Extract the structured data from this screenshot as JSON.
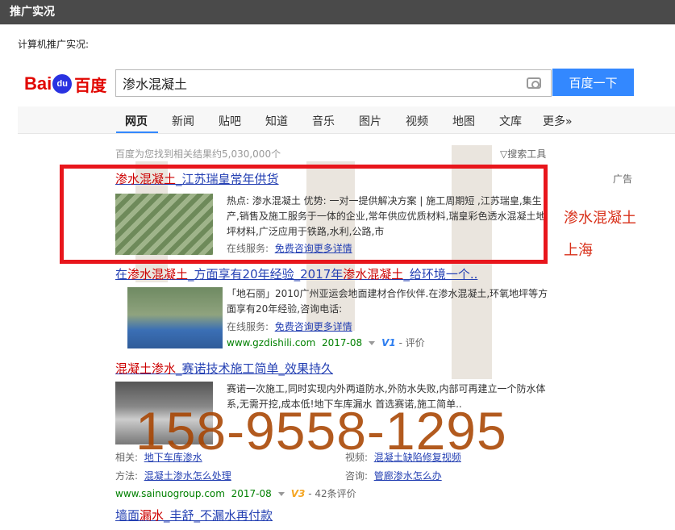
{
  "window": {
    "title": "推广实况"
  },
  "subtitle": "计算机推广实况:",
  "logo": {
    "bai": "Bai",
    "du": "du",
    "cn": "百度"
  },
  "search": {
    "query": "渗水混凝土",
    "button": "百度一下"
  },
  "nav": [
    "网页",
    "新闻",
    "贴吧",
    "知道",
    "音乐",
    "图片",
    "视频",
    "地图",
    "文库",
    "更多»"
  ],
  "result_count": "百度为您找到相关结果约5,030,000个",
  "search_tools": "搜索工具",
  "ad_label": "广告",
  "side_notes": [
    "渗水混凝土",
    "上海"
  ],
  "results": [
    {
      "title_em": "渗水混凝土",
      "title_rest": "_江苏瑞皇常年供货",
      "text": "热点: 渗水混凝土    优势: 一对一提供解决方案 | 施工周期短 ,江苏瑞皇,集生产,销售及施工服务于一体的企业,常年供应优质材料,瑞皇彩色透水混凝土地坪材料,广泛应用于铁路,水利,公路,市",
      "service_label": "在线服务:",
      "service_link": "免费咨询更多详情"
    },
    {
      "title_a": "在",
      "title_em1": "渗水混凝土",
      "title_b": "_方面享有20年经验_2017年",
      "title_em2": "渗水混凝土",
      "title_c": "_给环境一个..",
      "text": "「地石丽」2010广州亚运会地面建材合作伙伴.在渗水混凝土,环氧地坪等方面享有20年经验,咨询电话:",
      "service_label": "在线服务:",
      "service_link": "免费咨询更多详情",
      "url": "www.gzdishili.com",
      "date": "2017-08",
      "badge": "V1",
      "eval": "- 评价"
    },
    {
      "title_em": "混凝土渗水",
      "title_rest": "_赛诺技术施工简单_效果持久",
      "text": "赛诺一次施工,同时实现内外两道防水,外防水失败,内部可再建立一个防水体系,无需开挖,成本低!地下车库漏水 首选赛诺,施工简单..",
      "related_label": "相关:",
      "related_link": "地下车库渗水",
      "video_label": "视频:",
      "video_link": "混凝土缺陷修复视频",
      "method_label": "方法:",
      "method_link": "混凝土渗水怎么处理",
      "ask_label": "咨询:",
      "ask_link": "管廊渗水怎么办",
      "url": "www.sainuogroup.com",
      "date": "2017-08",
      "badge": "V3",
      "eval": "- 42条评价"
    },
    {
      "title_a": "墙面",
      "title_em": "漏水",
      "title_rest": "_丰舒_不漏水再付款"
    }
  ],
  "overlay_phone": "158-9558-1295"
}
